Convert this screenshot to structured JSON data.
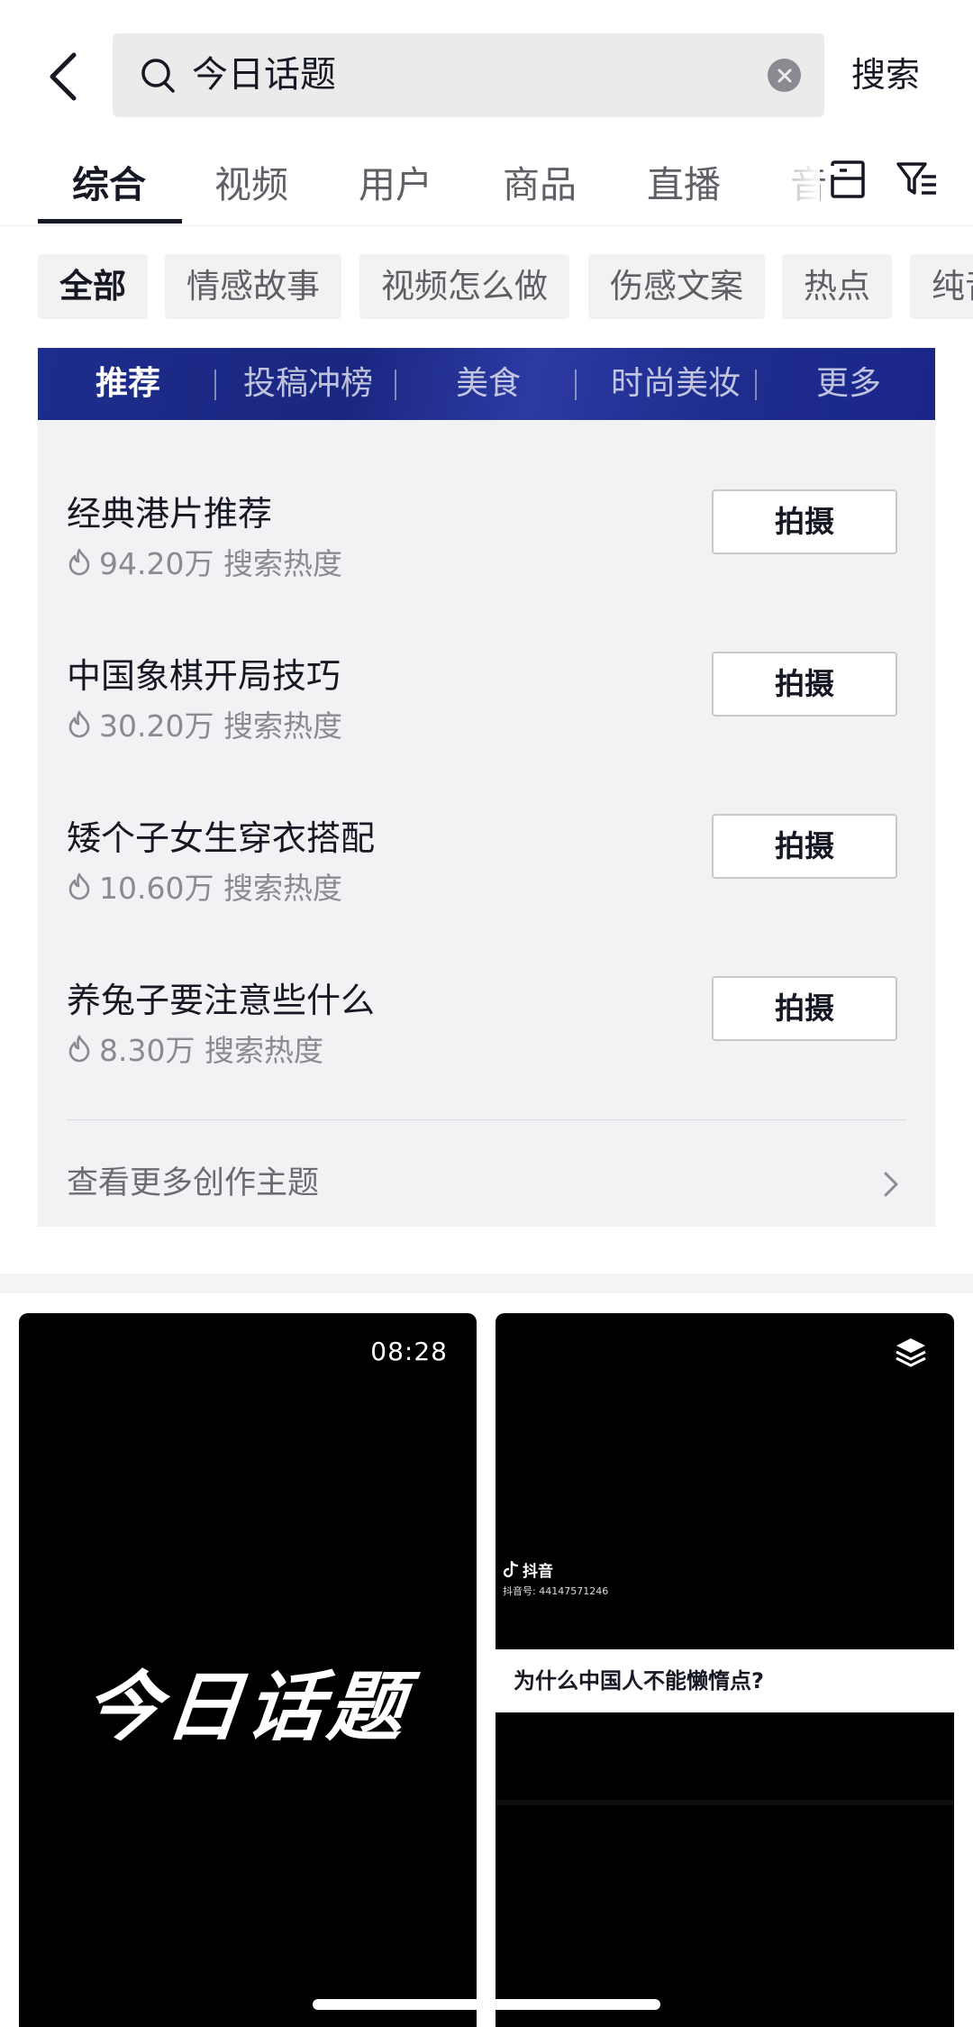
{
  "search": {
    "query": "今日话题",
    "submit_label": "搜索"
  },
  "tabs": [
    {
      "label": "综合",
      "active": true
    },
    {
      "label": "视频",
      "active": false
    },
    {
      "label": "用户",
      "active": false
    },
    {
      "label": "商品",
      "active": false
    },
    {
      "label": "直播",
      "active": false
    },
    {
      "label": "音",
      "active": false
    }
  ],
  "chips": [
    {
      "label": "全部",
      "active": true
    },
    {
      "label": "情感故事",
      "active": false
    },
    {
      "label": "视频怎么做",
      "active": false
    },
    {
      "label": "伤感文案",
      "active": false
    },
    {
      "label": "热点",
      "active": false
    },
    {
      "label": "纯音",
      "active": false
    }
  ],
  "panel": {
    "tabs": [
      {
        "label": "推荐",
        "active": true
      },
      {
        "label": "投稿冲榜",
        "active": false
      },
      {
        "label": "美食",
        "active": false
      },
      {
        "label": "时尚美妆",
        "active": false
      },
      {
        "label": "更多",
        "active": false
      }
    ],
    "topics": [
      {
        "title": "经典港片推荐",
        "heat": "94.20万",
        "heat_label": "搜索热度",
        "button": "拍摄"
      },
      {
        "title": "中国象棋开局技巧",
        "heat": "30.20万",
        "heat_label": "搜索热度",
        "button": "拍摄"
      },
      {
        "title": "矮个子女生穿衣搭配",
        "heat": "10.60万",
        "heat_label": "搜索热度",
        "button": "拍摄"
      },
      {
        "title": "养兔子要注意些什么",
        "heat": "8.30万",
        "heat_label": "搜索热度",
        "button": "拍摄"
      }
    ],
    "more_label": "查看更多创作主题"
  },
  "videos": {
    "left": {
      "duration": "08:28",
      "cover_title": "今日话题"
    },
    "right": {
      "brand": "抖音",
      "id_text": "抖音号: 44147571246",
      "caption": "为什么中国人不能懒惰点?"
    }
  },
  "icons": {
    "back": "chevron-left-icon",
    "search": "search-icon",
    "clear": "clear-icon",
    "layout": "layout-icon",
    "filter": "filter-icon",
    "flame": "flame-icon",
    "more": "chevron-right-icon",
    "stack": "stack-icon"
  }
}
